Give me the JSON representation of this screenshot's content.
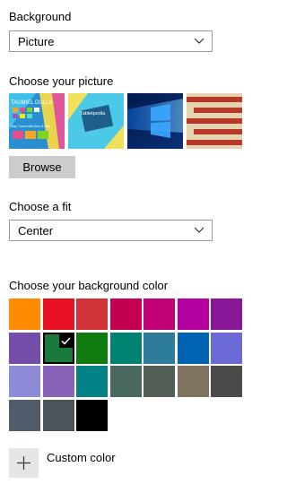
{
  "background": {
    "label": "Background",
    "selected": "Picture"
  },
  "picture": {
    "label": "Choose your picture",
    "thumbnails": [
      {
        "icon": "tile-wallpaper-thumbnail",
        "text_line1": "TAUMIEL DULLS",
        "text_line2": "Stay Tuned with Aero & Play"
      },
      {
        "icon": "tablet-wallpaper-thumbnail",
        "text_line1": "Tabletpedia"
      },
      {
        "icon": "windows-hero-wallpaper-thumbnail"
      },
      {
        "icon": "stripes-wallpaper-thumbnail"
      }
    ],
    "browse_label": "Browse"
  },
  "fit": {
    "label": "Choose a fit",
    "selected": "Center"
  },
  "color": {
    "label": "Choose your background color",
    "selected_index": 8,
    "swatches": [
      "#fd8c00",
      "#e81123",
      "#d13438",
      "#c30052",
      "#bf0077",
      "#b4009e",
      "#881798",
      "#744da9",
      "#1a7a3c",
      "#107c10",
      "#008272",
      "#2d7d9a",
      "#0063b1",
      "#6b69d6",
      "#8e8cd8",
      "#8764b8",
      "#038387",
      "#486860",
      "#525e54",
      "#7e735f",
      "#4c4a48",
      "#515c6b",
      "#4a5459",
      "#000000"
    ],
    "custom_label": "Custom color"
  },
  "colors": {
    "border": "#999999",
    "button": "#cccccc",
    "plus_button": "#e6e6e6"
  }
}
